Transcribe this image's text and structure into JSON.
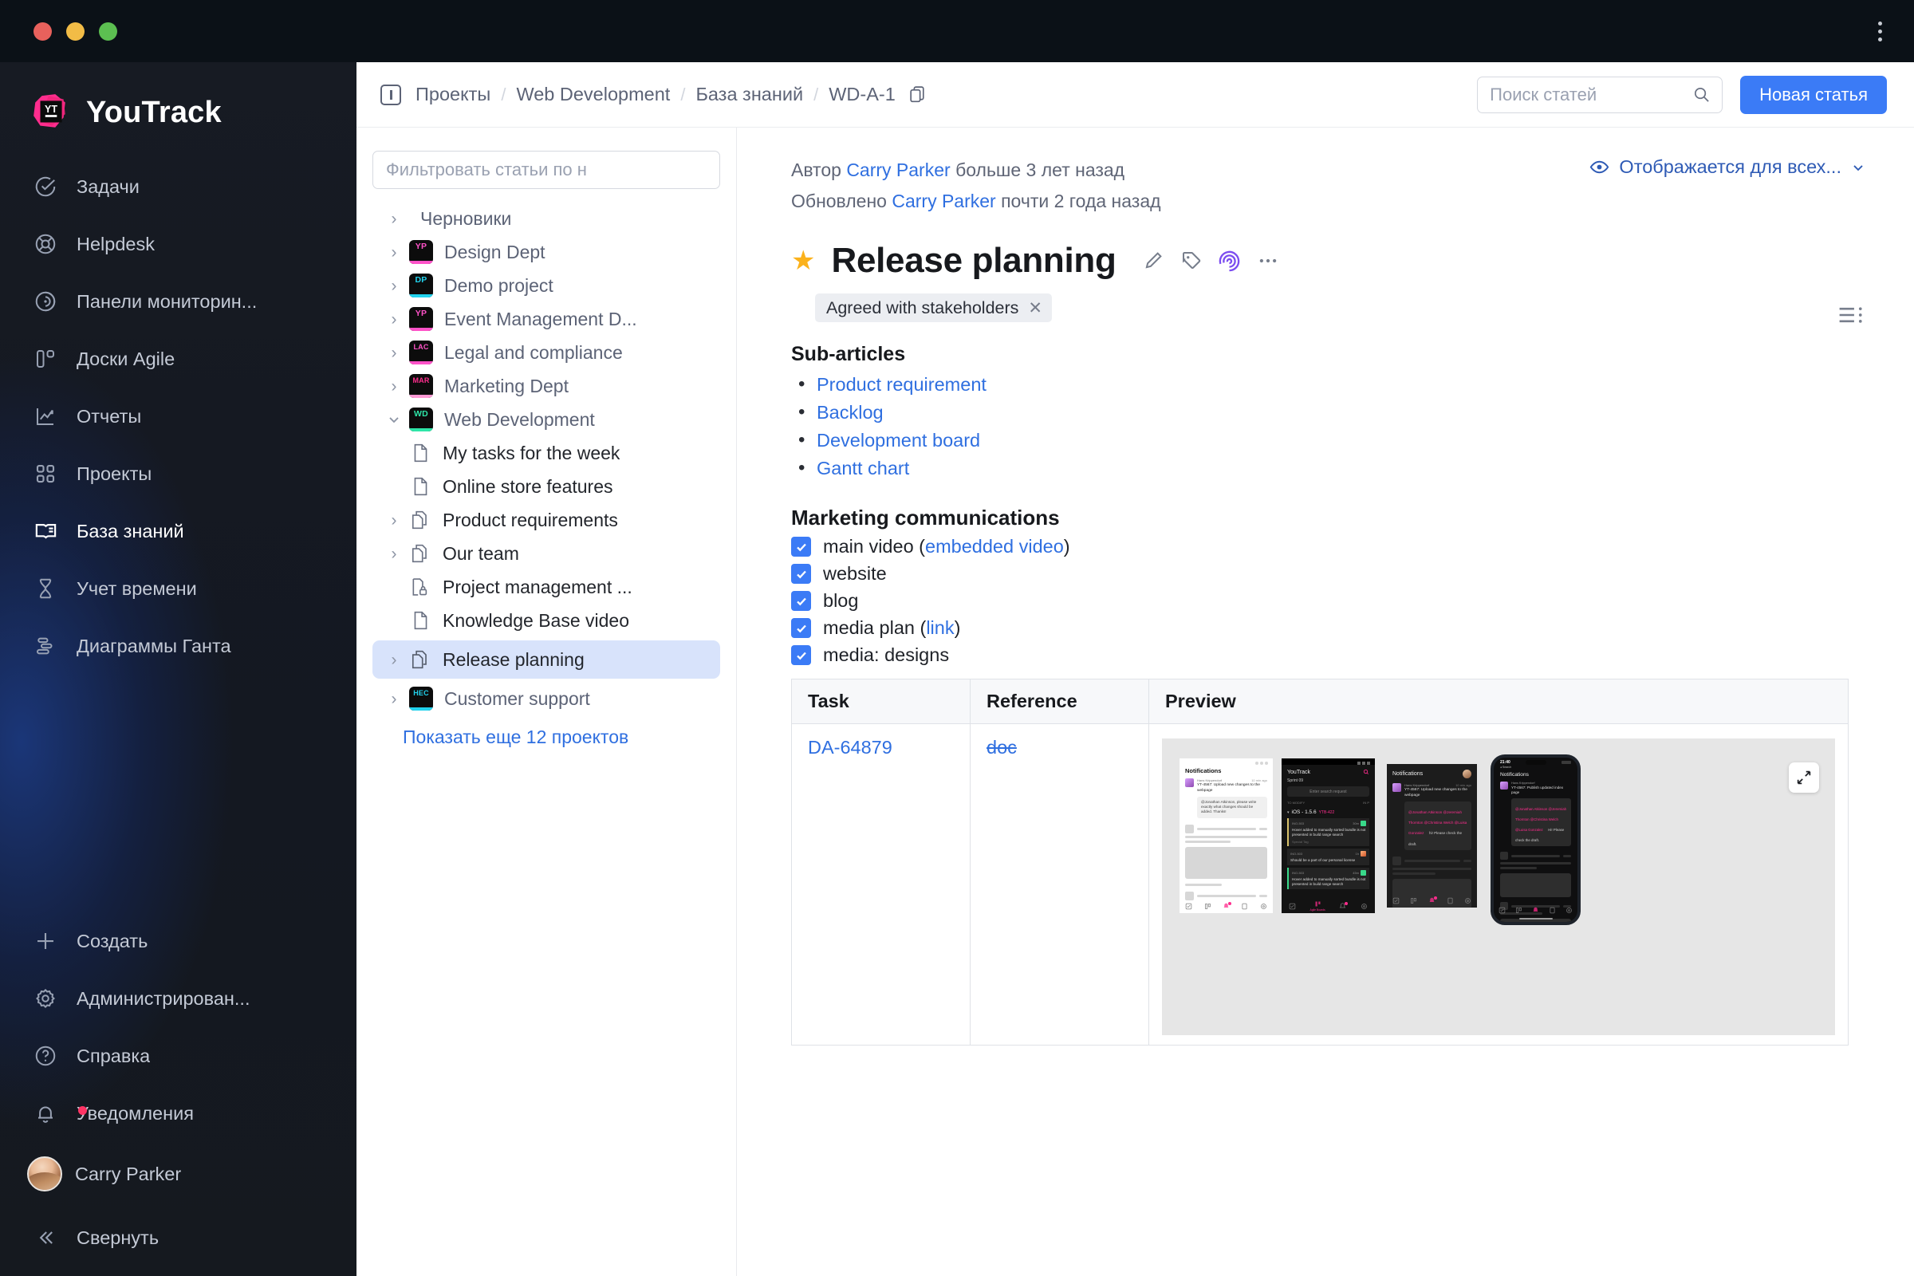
{
  "window": {
    "traffic_lights": [
      "close",
      "minimize",
      "zoom"
    ],
    "menu_icon": "kebab-menu-icon"
  },
  "sidebar": {
    "brand": "YouTrack",
    "items": [
      {
        "label": "Задачи",
        "icon": "check-circle-icon",
        "active": false
      },
      {
        "label": "Helpdesk",
        "icon": "lifebuoy-icon",
        "active": false
      },
      {
        "label": "Панели мониторин...",
        "icon": "dashboard-icon",
        "active": false
      },
      {
        "label": "Доски Agile",
        "icon": "agile-board-icon",
        "active": false
      },
      {
        "label": "Отчеты",
        "icon": "report-chart-icon",
        "active": false
      },
      {
        "label": "Проекты",
        "icon": "grid-icon",
        "active": false
      },
      {
        "label": "База знаний",
        "icon": "book-icon",
        "active": true
      },
      {
        "label": "Учет времени",
        "icon": "hourglass-icon",
        "active": false
      },
      {
        "label": "Диаграммы Ганта",
        "icon": "gantt-icon",
        "active": false
      }
    ],
    "bottom_items": [
      {
        "label": "Создать",
        "icon": "plus-icon"
      },
      {
        "label": "Администрирован...",
        "icon": "gear-icon"
      },
      {
        "label": "Справка",
        "icon": "question-circle-icon"
      },
      {
        "label": "Уведомления",
        "icon": "bell-icon",
        "badge": true
      }
    ],
    "user": {
      "name": "Carry Parker",
      "icon": "avatar"
    },
    "collapse": {
      "label": "Свернуть",
      "icon": "chevrons-left-icon"
    }
  },
  "topbar": {
    "panel_icon": "panel-toggle-icon",
    "breadcrumbs": [
      "Проекты",
      "Web Development",
      "База знаний",
      "WD-A-1"
    ],
    "breadcrumb_separator": "/",
    "article_id_icon": "copy-icon",
    "search": {
      "placeholder": "Поиск статей",
      "value": "",
      "icon": "search-icon"
    },
    "new_article_button": "Новая статья"
  },
  "tree": {
    "filter": {
      "placeholder": "Фильтровать статьи по н",
      "value": ""
    },
    "items": [
      {
        "label": "Черновики",
        "type": "folder",
        "expandable": true,
        "expanded": false,
        "indent": 0
      },
      {
        "label": "Design Dept",
        "type": "project",
        "short": "YP",
        "text_color": "#ff52c8",
        "bar_color": "#ff52c8",
        "expandable": true,
        "expanded": false,
        "indent": 0
      },
      {
        "label": "Demo project",
        "type": "project",
        "short": "DP",
        "text_color": "#22d3ee",
        "bar_color": "#22d3ee",
        "expandable": true,
        "expanded": false,
        "indent": 0
      },
      {
        "label": "Event Management D...",
        "type": "project",
        "short": "YP",
        "text_color": "#ff52c8",
        "bar_color": "#ff52c8",
        "expandable": true,
        "expanded": false,
        "indent": 0
      },
      {
        "label": "Legal and compliance",
        "type": "project",
        "short": "LAC",
        "text_color": "#ff52c8",
        "bar_color": "#ff52c8",
        "expandable": true,
        "expanded": false,
        "indent": 0
      },
      {
        "label": "Marketing Dept",
        "type": "project",
        "short": "MAR",
        "text_color": "#ff2d8e",
        "bar_color": "#ff9ad5",
        "expandable": true,
        "expanded": false,
        "indent": 0
      },
      {
        "label": "Web Development",
        "type": "project",
        "short": "WD",
        "text_color": "#2ee6a8",
        "bar_color": "#2ee6a8",
        "expandable": true,
        "expanded": true,
        "indent": 0
      },
      {
        "label": "My tasks for the week",
        "type": "article",
        "icon": "document-icon",
        "expandable": false,
        "indent": 1
      },
      {
        "label": "Online store features",
        "type": "article",
        "icon": "document-icon",
        "expandable": false,
        "indent": 1
      },
      {
        "label": "Product requirements",
        "type": "article",
        "icon": "documents-icon",
        "expandable": true,
        "expanded": false,
        "indent": 1
      },
      {
        "label": "Our team",
        "type": "article",
        "icon": "documents-icon",
        "expandable": true,
        "expanded": false,
        "indent": 1
      },
      {
        "label": "Project management ...",
        "type": "article",
        "icon": "document-lock-icon",
        "expandable": false,
        "indent": 1
      },
      {
        "label": "Knowledge Base video",
        "type": "article",
        "icon": "document-icon",
        "expandable": false,
        "indent": 1
      },
      {
        "label": "Release planning",
        "type": "article",
        "icon": "documents-icon",
        "expandable": true,
        "expanded": false,
        "indent": 1,
        "selected": true
      },
      {
        "label": "Customer support",
        "type": "project",
        "short": "HEC",
        "text_color": "#22d3ee",
        "bar_color": "#22d3ee",
        "expandable": true,
        "expanded": false,
        "indent": 0
      }
    ],
    "show_more": "Показать еще 12 проектов"
  },
  "article": {
    "author_prefix": "Автор",
    "author_name": "Carry Parker",
    "author_time": "больше 3 лет назад",
    "updated_prefix": "Обновлено",
    "updated_name": "Carry Parker",
    "updated_time": "почти 2 года назад",
    "visibility": {
      "label": "Отображается для всех...",
      "icon": "eye-icon",
      "chevron": "chevron-down-icon"
    },
    "star_icon": "star-filled-icon",
    "title": "Release planning",
    "actions": [
      {
        "name": "edit-pencil-icon"
      },
      {
        "name": "tag-icon"
      },
      {
        "name": "spiral-ai-icon"
      },
      {
        "name": "more-dots-icon"
      }
    ],
    "toc_icon": "table-of-contents-icon",
    "tag": {
      "label": "Agreed with stakeholders",
      "remove_icon": "close-icon"
    },
    "subarticles_heading": "Sub-articles",
    "subarticles": [
      "Product requirement",
      "Backlog",
      "Development board",
      "Gantt chart"
    ],
    "marketing_heading": "Marketing communications",
    "checklist": [
      {
        "checked": true,
        "text": "main video (",
        "link": "embedded video",
        "suffix": ")"
      },
      {
        "checked": true,
        "text": "website",
        "link": "",
        "suffix": ""
      },
      {
        "checked": true,
        "text": "blog",
        "link": "",
        "suffix": ""
      },
      {
        "checked": true,
        "text": "media plan (",
        "link": "link",
        "suffix": ")"
      },
      {
        "checked": true,
        "text": "media: designs",
        "link": "",
        "suffix": ""
      }
    ],
    "table": {
      "headers": [
        "Task",
        "Reference",
        "Preview"
      ],
      "rows": [
        {
          "task": "DA-64879",
          "reference": "doc",
          "reference_strikethrough": true
        }
      ]
    },
    "preview": {
      "expand_icon": "expand-arrows-icon",
      "mockups": [
        {
          "theme": "light",
          "title": "Notifications",
          "sender": "Hans Krippendorf",
          "time": "10 min ago",
          "subject": "YT-4567: Upload new changes to the webpage",
          "body": "@Jonathan Atkinson, please write exactly what changes should be added. Thanks!"
        },
        {
          "theme": "dark",
          "app": "YouTrack",
          "sprint": "Sprint 09",
          "search_placeholder": "Enter search request",
          "columns": [
            "TO MODIFY",
            "IN P"
          ],
          "group": "iOS - 1.5.6",
          "group_tag": "YTB-422",
          "cards": [
            {
              "id": "INO-503",
              "age": "30m",
              "text": "Hover added to manually sorted bundle is not presented in build range search",
              "tag": "Special Tag"
            },
            {
              "id": "INO-503",
              "age": "1h",
              "text": "Should be a part of our personal license"
            },
            {
              "id": "INO-503",
              "age": "45m",
              "text": "Hover added to manually sorted bundle is not presented in build range search"
            }
          ],
          "nav_label": "Agile Boards"
        },
        {
          "theme": "dark",
          "title": "Notifications",
          "sender": "Hans Krippendorf",
          "time": "10 min ago",
          "subject": "YT-4567: Upload new changes to the webpage",
          "mentions": "@Jonathan Atkinson @Jeremiah Thornton @Christina Welch @Luisa Gonzalez",
          "body": "hi! Please check the draft."
        },
        {
          "theme": "dark-device",
          "status_time": "21:40",
          "status_back": "Search",
          "title": "Notifications",
          "sender": "Hans Krippendorf",
          "subject": "YT-4567: Publish updated index page",
          "mentions": "@Jonathan Atkinson @Jeremiah Thornton @Christina Welch @Luisa Gonzalez",
          "body": "Hi! Please check the draft."
        }
      ]
    }
  },
  "colors": {
    "accent_blue": "#3b7bf6",
    "link_blue": "#2f6fe0",
    "selected_row": "#d8e3fb",
    "star_gold": "#fbb21c",
    "ai_purple": "#7c4df0",
    "badge_pink": "#ff3465",
    "nav_bg_dark": "#151922",
    "nav_glow_blue": "#1b387d"
  }
}
